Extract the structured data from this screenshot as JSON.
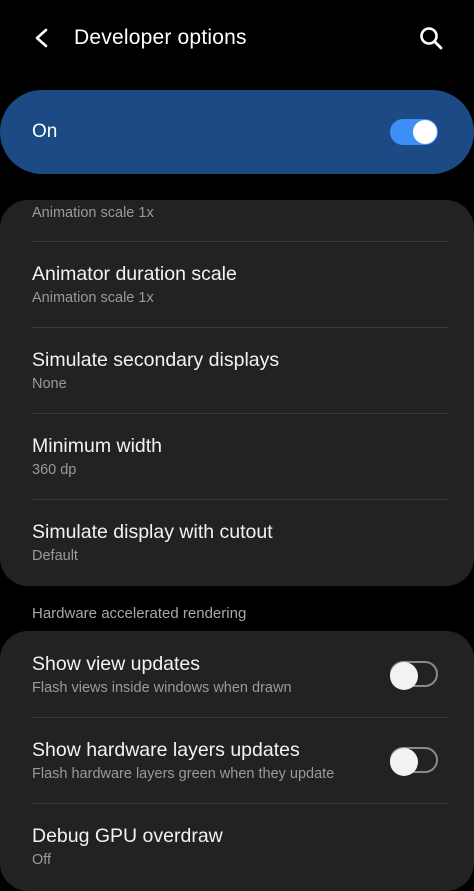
{
  "header": {
    "title": "Developer options",
    "back_icon": "arrow-back-icon",
    "search_icon": "search-icon"
  },
  "master_switch": {
    "label": "On",
    "state": "on",
    "accent_color": "#3e8ef7",
    "card_color": "#1c4a85"
  },
  "drawing_group": {
    "partial_item": {
      "summary": "Animation scale 1x"
    },
    "items": [
      {
        "title": "Animator duration scale",
        "summary": "Animation scale 1x"
      },
      {
        "title": "Simulate secondary displays",
        "summary": "None"
      },
      {
        "title": "Minimum width",
        "summary": "360 dp"
      },
      {
        "title": "Simulate display with cutout",
        "summary": "Default"
      }
    ]
  },
  "hardware_section": {
    "header": "Hardware accelerated rendering",
    "items": [
      {
        "title": "Show view updates",
        "summary": "Flash views inside windows when drawn",
        "toggle": "off"
      },
      {
        "title": "Show hardware layers updates",
        "summary": "Flash hardware layers green when they update",
        "toggle": "off"
      },
      {
        "title": "Debug GPU overdraw",
        "summary": "Off"
      }
    ]
  }
}
